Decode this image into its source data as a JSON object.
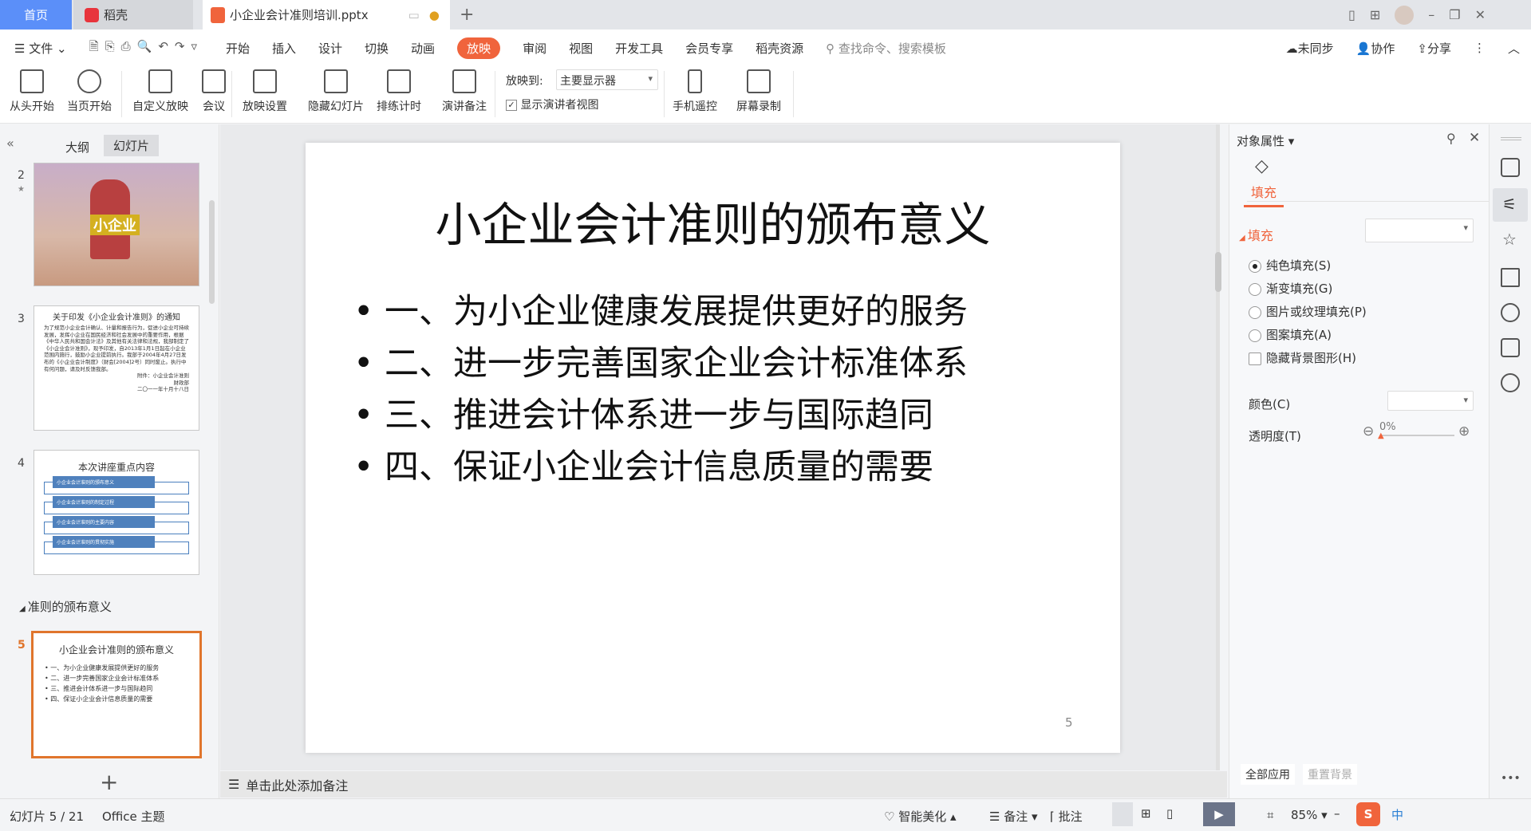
{
  "tabs": [
    {
      "label": "首页",
      "active": false
    },
    {
      "label": "稻壳"
    },
    {
      "label": "小企业会计准则培训.pptx",
      "active": true
    }
  ],
  "menu": {
    "file": "文件",
    "items": [
      "开始",
      "插入",
      "设计",
      "切换",
      "动画",
      "放映",
      "审阅",
      "视图",
      "开发工具",
      "会员专享",
      "稻壳资源"
    ],
    "active": "放映",
    "search_placeholder": "查找命令、搜索模板",
    "sync": "未同步",
    "collab": "协作",
    "share": "分享"
  },
  "ribbon": {
    "buttons": [
      "从头开始",
      "当页开始",
      "自定义放映",
      "会议",
      "放映设置",
      "隐藏幻灯片",
      "排练计时",
      "演讲备注",
      "手机遥控",
      "屏幕录制"
    ],
    "show_to_label": "放映到:",
    "show_to_value": "主要显示器",
    "presenter_view": "显示演讲者视图",
    "presenter_view_checked": true
  },
  "left_panel": {
    "tab_outline": "大纲",
    "tab_slides": "幻灯片",
    "section_label": "准则的颁布意义",
    "slides": [
      {
        "num": "2",
        "caption": "小企业"
      },
      {
        "num": "3",
        "title": "关于印发《小企业会计准则》的通知",
        "body": "为了规范小企业会计确认、计量和报告行为，促进小企业可持续发展，发挥小企业在国民经济和社会发展中的重要作用，根据《中华人民共和国会计法》及其他有关法律和法规，我部制定了《小企业会计准则》，现予印发，自2013年1月1日起在小企业范围内施行，鼓励小企业提前执行。我部于2004年4月27日发布的《小企业会计制度》（财会[2004]2号）同时废止。执行中有何问题，请及时反馈我部。",
        "sign": [
          "附件：小企业会计准则",
          "财政部",
          "二〇一一年十月十八日"
        ]
      },
      {
        "num": "4",
        "title": "本次讲座重点内容",
        "items": [
          "小企业会计准则的颁布意义",
          "小企业会计准则的制定过程",
          "小企业会计准则的主要内容",
          "小企业会计准则的贯彻实施"
        ]
      },
      {
        "num": "5",
        "title": "小企业会计准则的颁布意义",
        "items": [
          "一、为小企业健康发展提供更好的服务",
          "二、进一步完善国家企业会计标准体系",
          "三、推进会计体系进一步与国际趋同",
          "四、保证小企业会计信息质量的需要"
        ]
      }
    ]
  },
  "slide": {
    "title": "小企业会计准则的颁布意义",
    "bullets": [
      "一、为小企业健康发展提供更好的服务",
      "二、进一步完善国家企业会计标准体系",
      "三、推进会计体系进一步与国际趋同",
      "四、保证小企业会计信息质量的需要"
    ],
    "page_number": "5"
  },
  "notes_placeholder": "单击此处添加备注",
  "props": {
    "title": "对象属性",
    "tab": "填充",
    "section": "填充",
    "options": [
      "纯色填充(S)",
      "渐变填充(G)",
      "图片或纹理填充(P)",
      "图案填充(A)"
    ],
    "selected": "纯色填充(S)",
    "hide_bg": "隐藏背景图形(H)",
    "color_label": "颜色(C)",
    "transparency_label": "透明度(T)",
    "transparency": "0%",
    "apply_all": "全部应用",
    "reset_bg": "重置背景"
  },
  "status": {
    "slide_info": "幻灯片 5 / 21",
    "theme": "Office 主题",
    "beautify": "智能美化",
    "notes": "备注",
    "comment": "批注",
    "zoom": "85%"
  },
  "colors": {
    "accent": "#f0643c",
    "home_tab": "#5b8ff9",
    "selected_thumb": "#e0752c"
  }
}
